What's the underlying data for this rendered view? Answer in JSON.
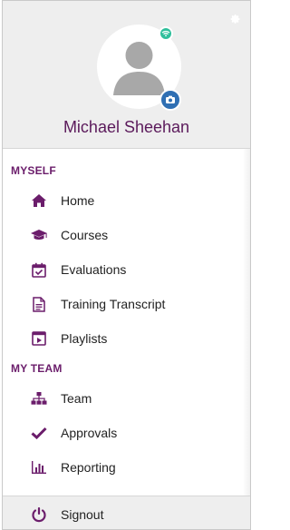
{
  "profile": {
    "user_name": "Michael Sheehan"
  },
  "sections": {
    "myself": {
      "title": "MYSELF",
      "items": [
        {
          "label": "Home",
          "icon": "home-icon"
        },
        {
          "label": "Courses",
          "icon": "graduation-cap-icon"
        },
        {
          "label": "Evaluations",
          "icon": "calendar-check-icon"
        },
        {
          "label": "Training Transcript",
          "icon": "document-icon"
        },
        {
          "label": "Playlists",
          "icon": "playlist-icon"
        }
      ]
    },
    "my_team": {
      "title": "MY TEAM",
      "items": [
        {
          "label": "Team",
          "icon": "org-chart-icon"
        },
        {
          "label": "Approvals",
          "icon": "checkmark-icon"
        },
        {
          "label": "Reporting",
          "icon": "bar-chart-icon"
        }
      ]
    }
  },
  "footer": {
    "signout_label": "Signout",
    "icon": "power-icon"
  },
  "colors": {
    "accent": "#6b1d6b",
    "header_bg": "#eeeeee",
    "status_dot": "#2fbf9b",
    "camera_button": "#2f6fb3"
  }
}
